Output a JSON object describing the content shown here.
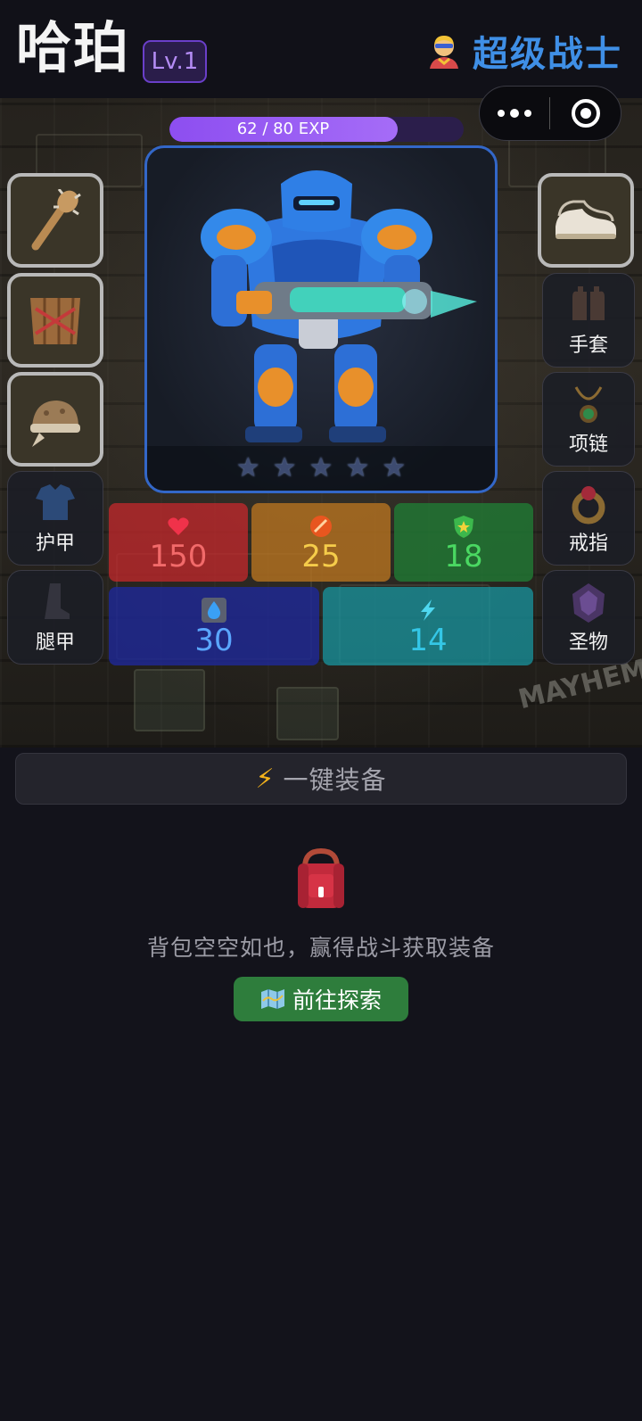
{
  "character": {
    "name": "哈珀",
    "level": "Lv.1",
    "class_name": "超级战士",
    "class_icon": "superhero-icon"
  },
  "experience": {
    "text": "62 / 80 EXP",
    "current": 62,
    "max": 80
  },
  "portrait": {
    "stars_filled": 0,
    "stars_total": 5
  },
  "left_slots": [
    {
      "label": "",
      "item": "spiked-club-icon",
      "equipped": true
    },
    {
      "label": "",
      "item": "wooden-shield-icon",
      "equipped": true
    },
    {
      "label": "",
      "item": "leather-helmet-icon",
      "equipped": true
    },
    {
      "label": "护甲",
      "item": "armor-icon",
      "equipped": false
    },
    {
      "label": "腿甲",
      "item": "greaves-icon",
      "equipped": false
    }
  ],
  "right_slots": [
    {
      "label": "",
      "item": "sneakers-icon",
      "equipped": true
    },
    {
      "label": "手套",
      "item": "gloves-icon",
      "equipped": false
    },
    {
      "label": "项链",
      "item": "necklace-icon",
      "equipped": false
    },
    {
      "label": "戒指",
      "item": "ring-icon",
      "equipped": false
    },
    {
      "label": "圣物",
      "item": "relic-icon",
      "equipped": false
    }
  ],
  "stats": {
    "hp": "150",
    "attack": "25",
    "defense": "18",
    "mana": "30",
    "speed": "14"
  },
  "stat_colors": {
    "hp": "#f04848",
    "attack": "#f2c238",
    "defense": "#43d35a",
    "mana": "#5aa6ff",
    "speed": "#34c6e6"
  },
  "actions": {
    "one_click_equip": "一键装备",
    "empty_bag_text": "背包空空如也，赢得战斗获取装备",
    "explore_button": "前往探索"
  },
  "scene_graffiti": "MAYHEM",
  "colors": {
    "accent_purple": "#8d4ef0",
    "accent_blue": "#3f8fe6",
    "explore_green": "#2e7d3c"
  }
}
